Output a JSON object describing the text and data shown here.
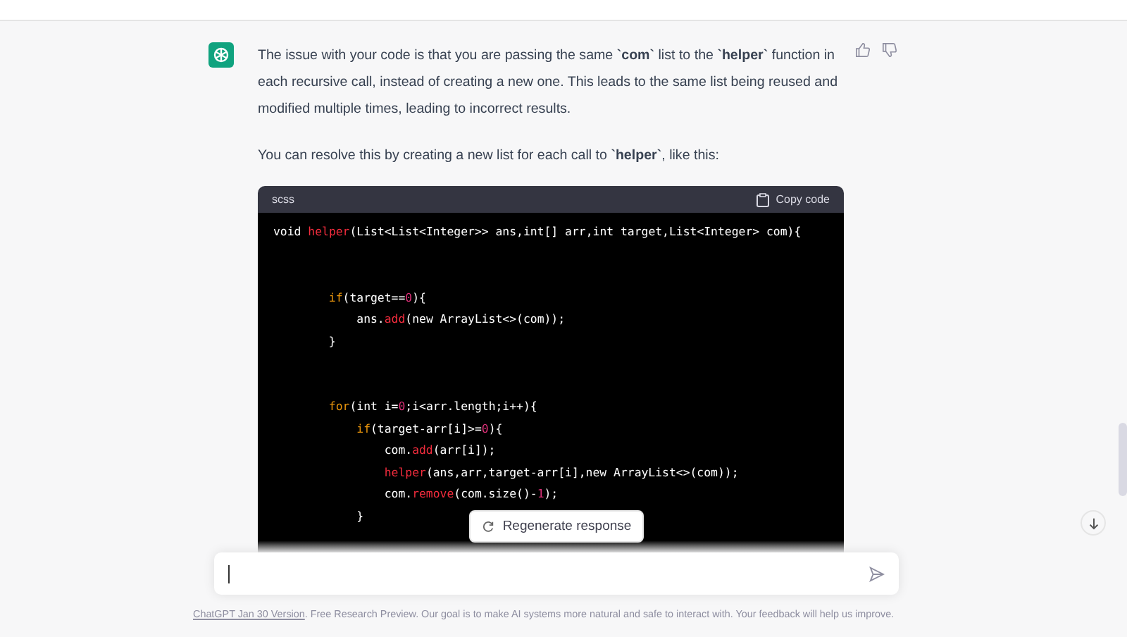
{
  "message": {
    "paragraphs": [
      "The issue with your code is that you are passing the same **`com`** list to the **`helper`** function in each recursive call, instead of creating a new one. This leads to the same list being reused and modified multiple times, leading to incorrect results.",
      "You can resolve this by creating a new list for each call to **`helper`**, like this:"
    ]
  },
  "code_block": {
    "language": "scss",
    "copy_label": "Copy code",
    "lines": [
      {
        "kind": "code",
        "segments": [
          {
            "text": "void ",
            "kind": "plain"
          },
          {
            "text": "helper",
            "kind": "function"
          },
          {
            "text": "(List<List<Integer>> ans,int[] arr,int target,List<Integer> com){",
            "kind": "plain"
          }
        ],
        "children": [
          {
            "kind": "blank"
          },
          {
            "kind": "blank"
          },
          {
            "kind": "code",
            "segments": [
              {
                "text": "if",
                "kind": "keyword"
              },
              {
                "text": "(target==",
                "kind": "plain"
              },
              {
                "text": "0",
                "kind": "number"
              },
              {
                "text": "){",
                "kind": "plain"
              }
            ],
            "children": [
              {
                "kind": "code",
                "segments": [
                  {
                    "text": "ans.",
                    "kind": "plain"
                  },
                  {
                    "text": "add",
                    "kind": "function"
                  },
                  {
                    "text": "(new ArrayList<>(com));",
                    "kind": "plain"
                  }
                ]
              }
            ]
          },
          {
            "kind": "code",
            "segments": [
              {
                "text": "}",
                "kind": "plain"
              }
            ]
          },
          {
            "kind": "blank"
          },
          {
            "kind": "blank"
          },
          {
            "kind": "code",
            "segments": [
              {
                "text": "for",
                "kind": "keyword"
              },
              {
                "text": "(int i=",
                "kind": "plain"
              },
              {
                "text": "0",
                "kind": "number"
              },
              {
                "text": ";i<arr.length;i++){",
                "kind": "plain"
              }
            ],
            "children": [
              {
                "kind": "code",
                "segments": [
                  {
                    "text": "if",
                    "kind": "keyword"
                  },
                  {
                    "text": "(target-arr[i]>=",
                    "kind": "plain"
                  },
                  {
                    "text": "0",
                    "kind": "number"
                  },
                  {
                    "text": "){",
                    "kind": "plain"
                  }
                ],
                "children": [
                  {
                    "kind": "code",
                    "segments": [
                      {
                        "text": "com.",
                        "kind": "plain"
                      },
                      {
                        "text": "add",
                        "kind": "function"
                      },
                      {
                        "text": "(arr[i]);",
                        "kind": "plain"
                      }
                    ]
                  },
                  {
                    "kind": "code",
                    "segments": [
                      {
                        "text": "helper",
                        "kind": "function"
                      },
                      {
                        "text": "(ans,arr,target-arr[i],new ArrayList<>(com));",
                        "kind": "plain"
                      }
                    ]
                  },
                  {
                    "kind": "code",
                    "segments": [
                      {
                        "text": "com.",
                        "kind": "plain"
                      },
                      {
                        "text": "remove",
                        "kind": "function"
                      },
                      {
                        "text": "(com.size()-",
                        "kind": "plain"
                      },
                      {
                        "text": "1",
                        "kind": "number"
                      },
                      {
                        "text": ");",
                        "kind": "plain"
                      }
                    ]
                  }
                ]
              },
              {
                "kind": "code",
                "segments": [
                  {
                    "text": "}",
                    "kind": "plain"
                  }
                ]
              }
            ]
          }
        ]
      }
    ]
  },
  "regenerate_button": "Regenerate response",
  "footer": {
    "link": "ChatGPT Jan 30 Version",
    "text": ". Free Research Preview. Our goal is to make AI systems more natural and safe to interact with. Your feedback will help us improve."
  }
}
